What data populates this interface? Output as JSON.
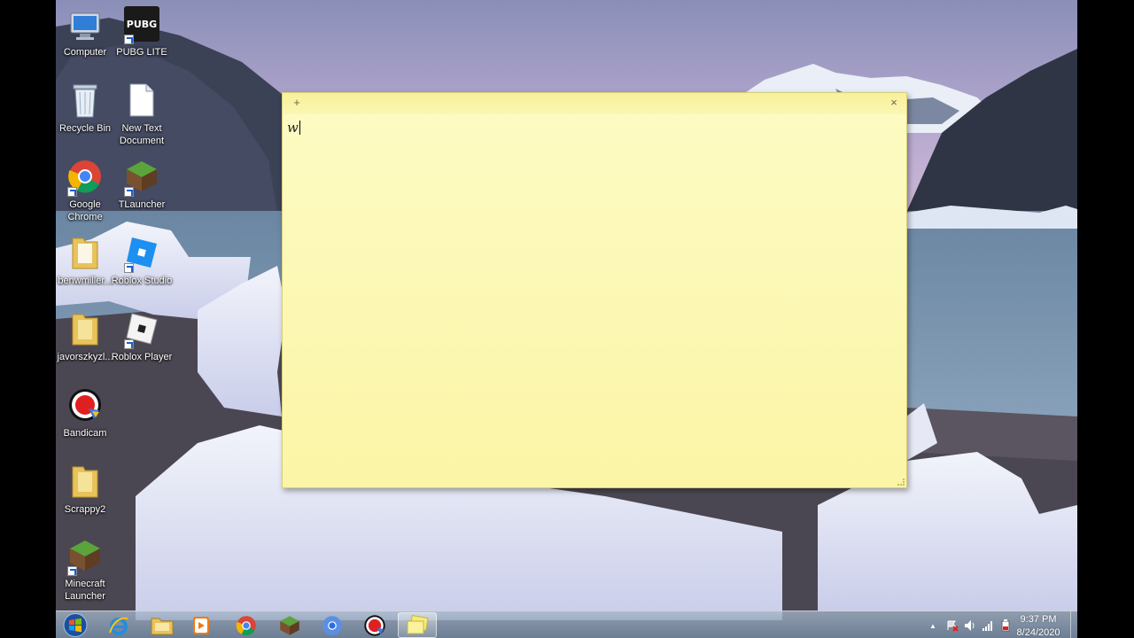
{
  "desktop": {
    "icons": [
      {
        "label": "Computer",
        "icon": "computer-icon"
      },
      {
        "label": "PUBG LITE",
        "icon": "pubg-lite-icon"
      },
      {
        "label": "Recycle Bin",
        "icon": "recycle-bin-icon"
      },
      {
        "label": "New Text Document",
        "icon": "text-document-icon"
      },
      {
        "label": "Google Chrome",
        "icon": "chrome-icon"
      },
      {
        "label": "TLauncher",
        "icon": "tlauncher-icon"
      },
      {
        "label": "benwmiller...",
        "icon": "folder-icon"
      },
      {
        "label": "Roblox Studio",
        "icon": "roblox-studio-icon"
      },
      {
        "label": "javorszkyzl...",
        "icon": "folder-icon"
      },
      {
        "label": "Roblox Player",
        "icon": "roblox-player-icon"
      },
      {
        "label": "Bandicam",
        "icon": "bandicam-icon"
      },
      {
        "label": "Scrappy2",
        "icon": "folder-icon"
      },
      {
        "label": "Minecraft Launcher",
        "icon": "minecraft-icon"
      }
    ],
    "pubg_logo_text": "PUBG"
  },
  "sticky_note": {
    "add_symbol": "+",
    "close_symbol": "×",
    "text": "w"
  },
  "taskbar": {
    "pinned": [
      {
        "name": "internet-explorer"
      },
      {
        "name": "file-explorer"
      },
      {
        "name": "media-player"
      },
      {
        "name": "google-chrome"
      },
      {
        "name": "minecraft"
      },
      {
        "name": "chromium"
      },
      {
        "name": "bandicam"
      },
      {
        "name": "sticky-notes"
      }
    ],
    "clock": {
      "time": "9:37 PM",
      "date": "8/24/2020"
    },
    "tray_arrow": "▲"
  },
  "colors": {
    "note_bg": "#fcf8b3",
    "note_bar": "#f8f09a",
    "taskbar": "#8a9fba"
  }
}
